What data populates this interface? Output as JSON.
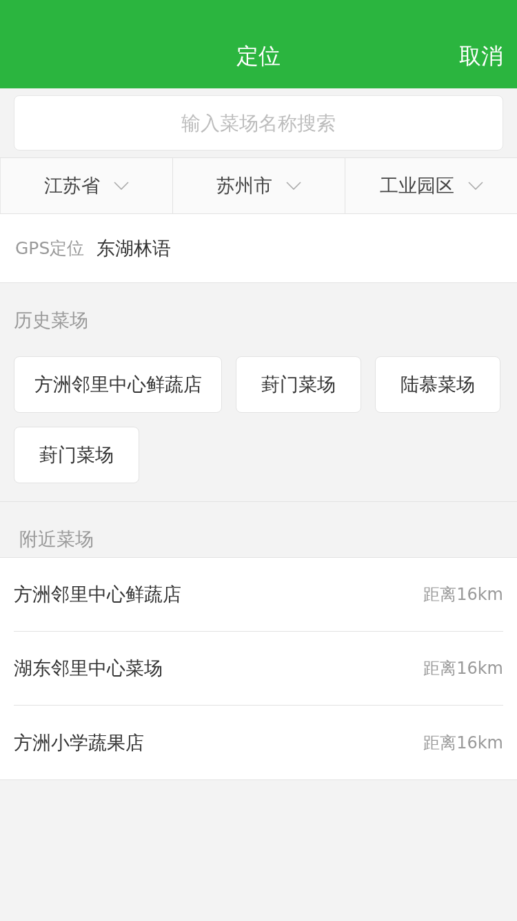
{
  "header": {
    "title": "定位",
    "cancel": "取消"
  },
  "search": {
    "placeholder": "输入菜场名称搜索"
  },
  "filters": [
    {
      "label": "江苏省"
    },
    {
      "label": "苏州市"
    },
    {
      "label": "工业园区"
    }
  ],
  "gps": {
    "label": "GPS定位",
    "value": "东湖林语"
  },
  "history": {
    "title": "历史菜场",
    "items": [
      "方洲邻里中心鲜蔬店",
      "葑门菜场",
      "陆慕菜场",
      "葑门菜场"
    ]
  },
  "nearby": {
    "title": "附近菜场",
    "items": [
      {
        "name": "方洲邻里中心鲜蔬店",
        "distance": "距离16km"
      },
      {
        "name": "湖东邻里中心菜场",
        "distance": "距离16km"
      },
      {
        "name": "方洲小学蔬果店",
        "distance": "距离16km"
      }
    ]
  }
}
